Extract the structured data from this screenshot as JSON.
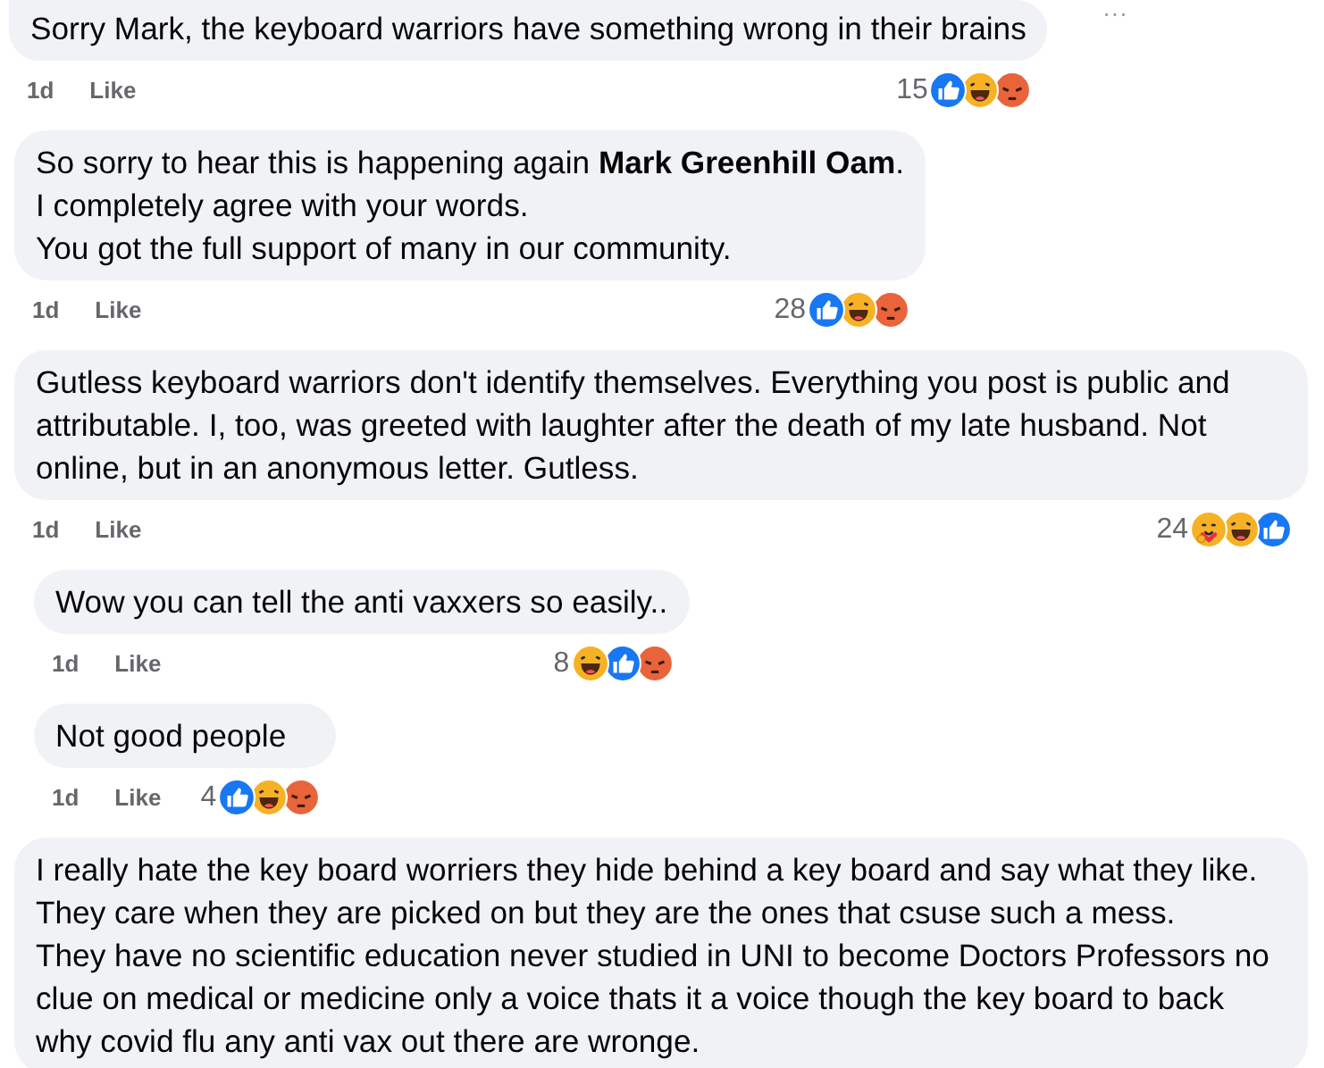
{
  "more_button": "···",
  "comments": [
    {
      "text": "Sorry Mark, the keyboard warriors have something wrong in their brains",
      "time": "1d",
      "like": "Like",
      "count": "15",
      "nested": false,
      "reactions": [
        {
          "kind": "like"
        },
        {
          "kind": "haha"
        },
        {
          "kind": "angry"
        }
      ]
    },
    {
      "text": "So sorry to hear this is happening again **Mark Greenhill Oam**.\nI completely agree with your words.\nYou got the full support of many in our community.",
      "time": "1d",
      "like": "Like",
      "count": "28",
      "nested": false,
      "reactions": [
        {
          "kind": "like"
        },
        {
          "kind": "haha"
        },
        {
          "kind": "angry"
        }
      ]
    },
    {
      "text": "Gutless keyboard warriors don't identify themselves. Everything you post is public and attributable. I, too, was greeted with laughter after the death of my late husband. Not online, but in an anonymous letter. Gutless.",
      "time": "1d",
      "like": "Like",
      "count": "24",
      "nested": false,
      "reactions": [
        {
          "kind": "care"
        },
        {
          "kind": "haha"
        },
        {
          "kind": "like"
        }
      ]
    },
    {
      "text": "Wow you can tell the anti vaxxers so easily..",
      "time": "1d",
      "like": "Like",
      "count": "8",
      "nested": true,
      "reactions": [
        {
          "kind": "haha"
        },
        {
          "kind": "like"
        },
        {
          "kind": "angry"
        }
      ]
    },
    {
      "text": "Not good people",
      "time": "1d",
      "like": "Like",
      "count": "4",
      "nested": true,
      "reactions": [
        {
          "kind": "like"
        },
        {
          "kind": "haha"
        },
        {
          "kind": "angry"
        }
      ]
    },
    {
      "text": "I really hate the key board worriers they hide behind a key board and say what they like.\nThey care when they are picked on but they are the ones that csuse such a mess.\nThey have no scientific education never studied in UNI to become Doctors Professors no clue on medical or medicine only a voice thats it a voice though the key board to back why covid flu any anti vax out there are wronge.",
      "nested": false
    }
  ]
}
